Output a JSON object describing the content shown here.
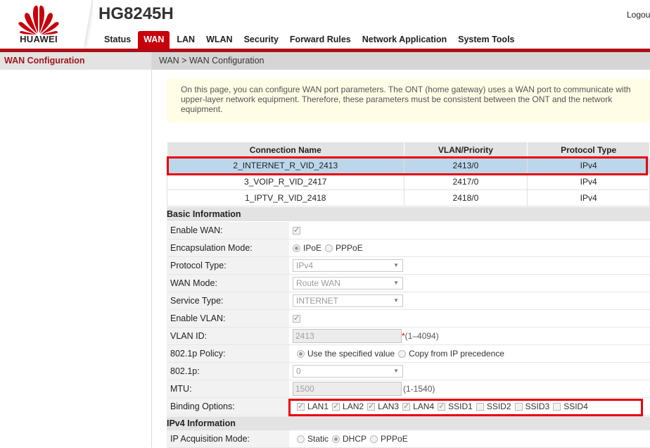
{
  "header": {
    "brand": "HUAWEI",
    "model": "HG8245H",
    "logout_label": "Logou"
  },
  "nav": [
    {
      "label": "Status",
      "active": false
    },
    {
      "label": "WAN",
      "active": true
    },
    {
      "label": "LAN",
      "active": false
    },
    {
      "label": "WLAN",
      "active": false
    },
    {
      "label": "Security",
      "active": false
    },
    {
      "label": "Forward Rules",
      "active": false
    },
    {
      "label": "Network Application",
      "active": false
    },
    {
      "label": "System Tools",
      "active": false
    }
  ],
  "sidebar": {
    "items": [
      {
        "label": "WAN Configuration"
      }
    ]
  },
  "breadcrumb": "WAN > WAN Configuration",
  "notice": "On this page, you can configure WAN port parameters. The ONT (home gateway) uses a WAN port to communicate with upper-layer network equipment. Therefore, these parameters must be consistent between the ONT and the network equipment.",
  "wan_table": {
    "headers": [
      "Connection Name",
      "VLAN/Priority",
      "Protocol Type"
    ],
    "rows": [
      {
        "name": "2_INTERNET_R_VID_2413",
        "vlan": "2413/0",
        "protocol": "IPv4",
        "selected": true
      },
      {
        "name": "3_VOIP_R_VID_2417",
        "vlan": "2417/0",
        "protocol": "IPv4",
        "selected": false
      },
      {
        "name": "1_IPTV_R_VID_2418",
        "vlan": "2418/0",
        "protocol": "IPv4",
        "selected": false
      }
    ]
  },
  "basic": {
    "title": "Basic Information",
    "enable_wan": {
      "label": "Enable WAN:",
      "checked": true
    },
    "encapsulation": {
      "label": "Encapsulation Mode:",
      "options": [
        "IPoE",
        "PPPoE"
      ],
      "selected": "IPoE"
    },
    "protocol_type": {
      "label": "Protocol Type:",
      "value": "IPv4"
    },
    "wan_mode": {
      "label": "WAN Mode:",
      "value": "Route WAN"
    },
    "service_type": {
      "label": "Service Type:",
      "value": "INTERNET"
    },
    "enable_vlan": {
      "label": "Enable VLAN:",
      "checked": true
    },
    "vlan_id": {
      "label": "VLAN ID:",
      "value": "2413",
      "required_mark": "*",
      "hint": "(1–4094)"
    },
    "policy_8021p": {
      "label": "802.1p Policy:",
      "options": [
        "Use the specified value",
        "Copy from IP precedence"
      ],
      "selected": "Use the specified value"
    },
    "p8021": {
      "label": "802.1p:",
      "value": "0"
    },
    "mtu": {
      "label": "MTU:",
      "value": "1500",
      "hint": "(1-1540)"
    },
    "binding": {
      "label": "Binding Options:",
      "options": [
        {
          "label": "LAN1",
          "checked": true
        },
        {
          "label": "LAN2",
          "checked": true
        },
        {
          "label": "LAN3",
          "checked": true
        },
        {
          "label": "LAN4",
          "checked": true
        },
        {
          "label": "SSID1",
          "checked": true
        },
        {
          "label": "SSID2",
          "checked": false
        },
        {
          "label": "SSID3",
          "checked": false
        },
        {
          "label": "SSID4",
          "checked": false
        }
      ]
    }
  },
  "ipv4": {
    "title": "IPv4 Information",
    "ip_acquisition": {
      "label": "IP Acquisition Mode:",
      "options": [
        "Static",
        "DHCP",
        "PPPoE"
      ],
      "selected": "DHCP"
    }
  },
  "colors": {
    "brand_red": "#c7000b",
    "highlight_box": "#e8000a",
    "selected_row": "#bcd7ec",
    "notice_bg": "#fffde6"
  }
}
